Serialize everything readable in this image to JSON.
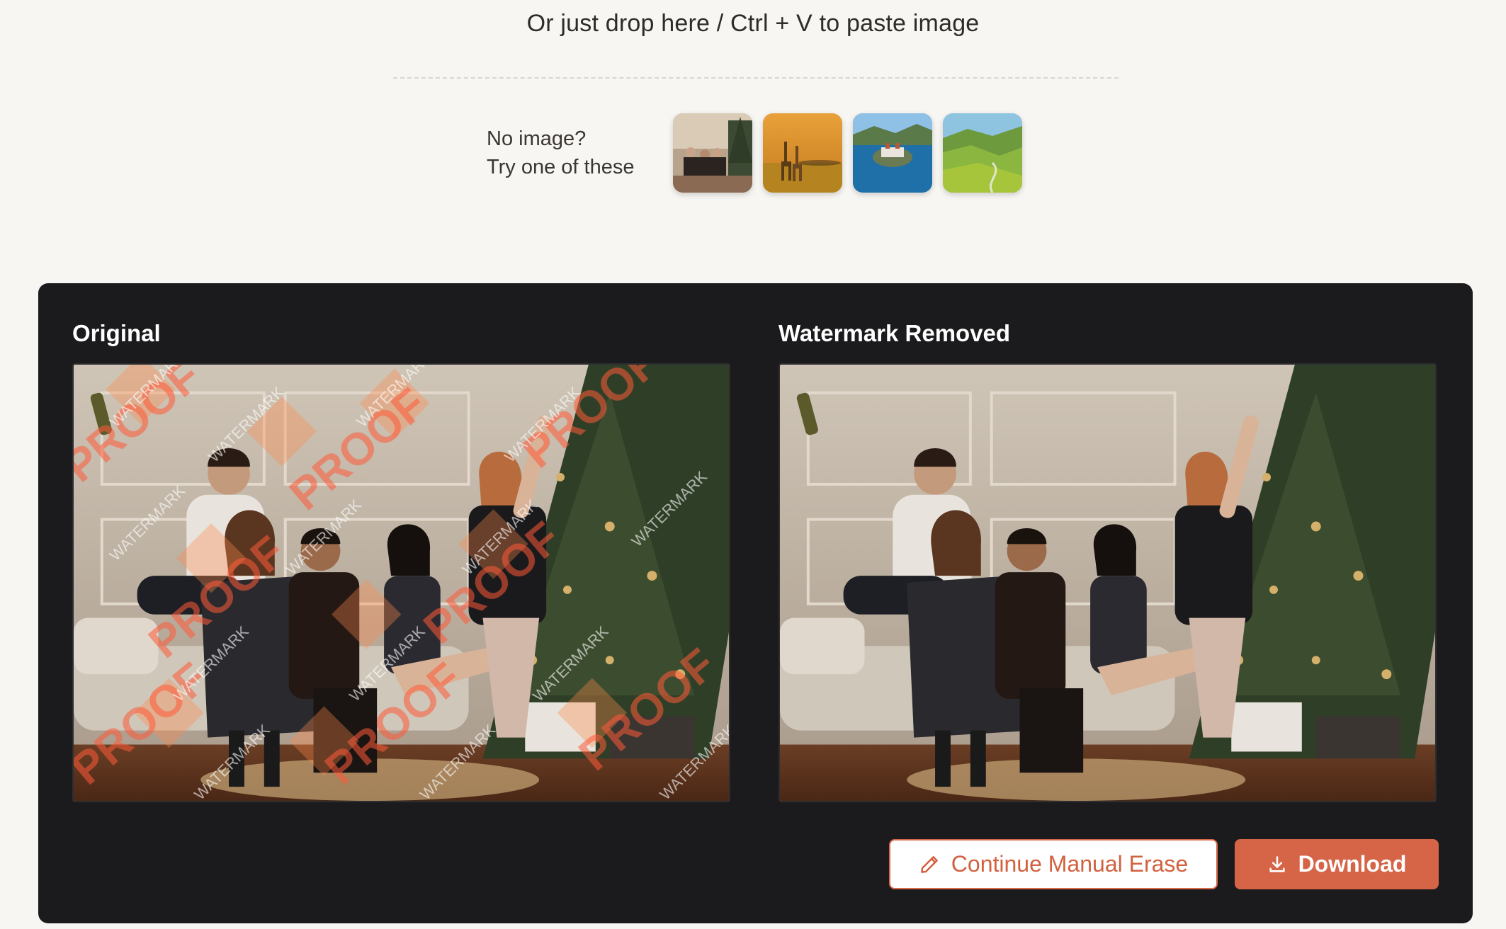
{
  "upload": {
    "drop_hint": "Or just drop here / Ctrl + V to paste image"
  },
  "samples": {
    "label_line1": "No image?",
    "label_line2": "Try one of these",
    "items": [
      {
        "icon": "party-photo-thumbnail"
      },
      {
        "icon": "giraffes-photo-thumbnail"
      },
      {
        "icon": "castle-lake-photo-thumbnail"
      },
      {
        "icon": "green-valley-photo-thumbnail"
      }
    ]
  },
  "comparison": {
    "original_title": "Original",
    "result_title": "Watermark Removed",
    "watermark_words": [
      "PROOF",
      "WATERMARK"
    ]
  },
  "actions": {
    "manual_erase_label": "Continue Manual Erase",
    "download_label": "Download",
    "accent_color": "#d66447"
  }
}
